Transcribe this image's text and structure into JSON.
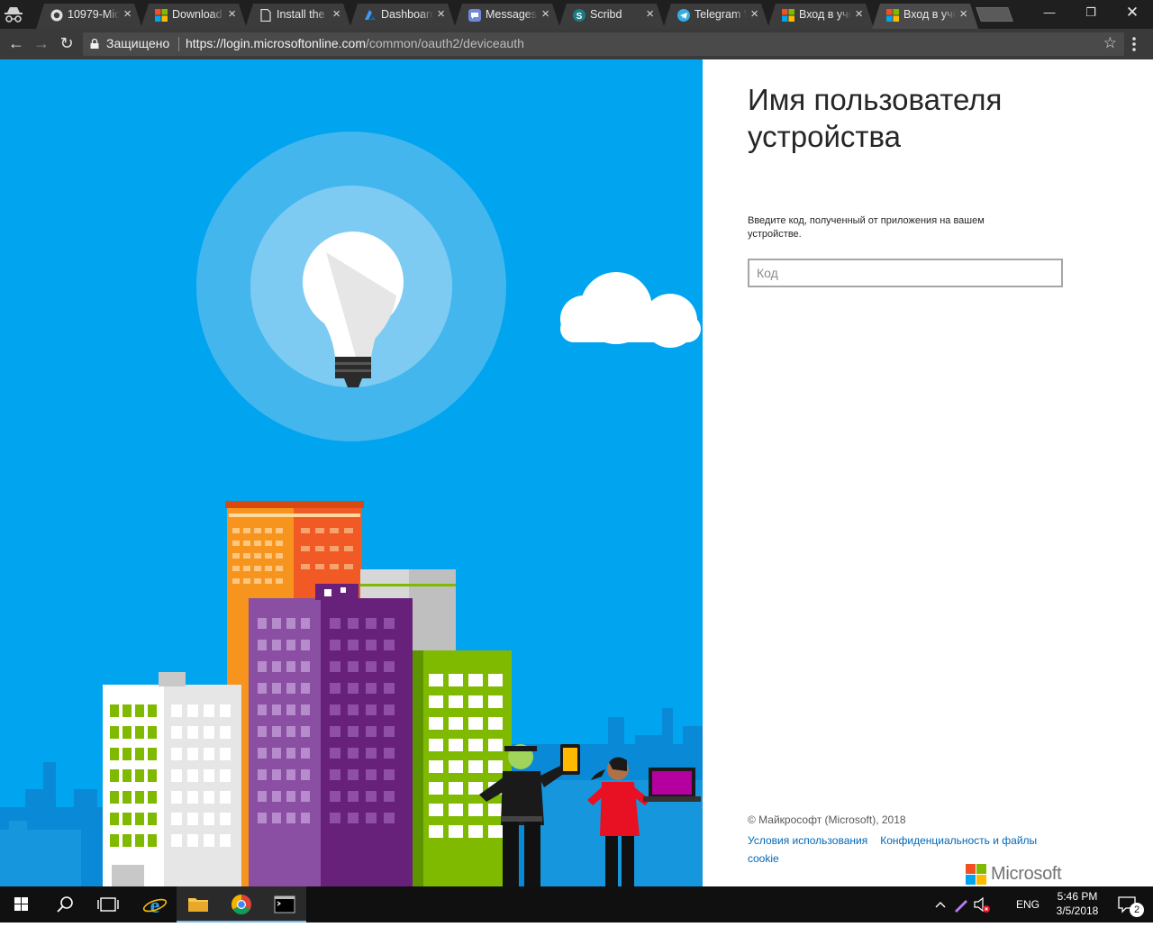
{
  "browser": {
    "tabs": [
      {
        "title": "10979-Mic",
        "icon": "github-icon"
      },
      {
        "title": "Download",
        "icon": "microsoft-icon"
      },
      {
        "title": "Install the",
        "icon": "page-icon"
      },
      {
        "title": "Dashboard",
        "icon": "azure-icon"
      },
      {
        "title": "Messages",
        "icon": "chat-icon"
      },
      {
        "title": "Scribd",
        "icon": "scribd-icon"
      },
      {
        "title": "Telegram W",
        "icon": "telegram-icon"
      },
      {
        "title": "Вход в учё",
        "icon": "microsoft-icon"
      },
      {
        "title": "Вход в учё",
        "icon": "microsoft-icon"
      }
    ],
    "security_label": "Защищено",
    "url_host": "https://login.microsoftonline.com",
    "url_path": "/common/oauth2/deviceauth"
  },
  "panel": {
    "title": "Имя пользователя устройства",
    "description": "Введите код, полученный от приложения на вашем устройстве.",
    "code_placeholder": "Код",
    "copyright": "© Майкрософт (Microsoft), 2018",
    "terms_link": "Условия использования",
    "privacy_link": "Конфиденциальность и файлы cookie",
    "logo_text": "Microsoft"
  },
  "colors": {
    "sky": "#00a4ef",
    "link": "#0067b8",
    "ms_red": "#f25022",
    "ms_green": "#7fba00",
    "ms_blue": "#00a4ef",
    "ms_yellow": "#ffb900"
  },
  "taskbar": {
    "language": "ENG",
    "time": "5:46 PM",
    "date": "3/5/2018",
    "notification_count": "2"
  }
}
